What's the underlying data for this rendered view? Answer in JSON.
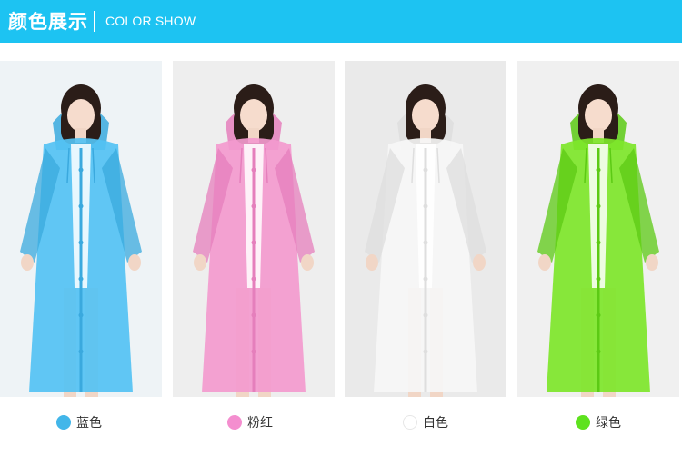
{
  "header": {
    "title_cn": "颜色展示",
    "title_en": "COLOR SHOW",
    "background": "#1dc3f2"
  },
  "products": [
    {
      "label": "蓝色",
      "swatch": "#42b6e9",
      "coat": "#54c2f3",
      "shade": "#3aa9de",
      "bg": "#eef3f6"
    },
    {
      "label": "粉红",
      "swatch": "#f48ecf",
      "coat": "#f39ace",
      "shade": "#e57fbc",
      "bg": "#eeeeee"
    },
    {
      "label": "白色",
      "swatch": "#ffffff",
      "coat": "#f6f6f6",
      "shade": "#dedede",
      "bg": "#eaeaea"
    },
    {
      "label": "绿色",
      "swatch": "#5ee21e",
      "coat": "#7ee62a",
      "shade": "#5cca14",
      "bg": "#f0f0f0"
    }
  ]
}
